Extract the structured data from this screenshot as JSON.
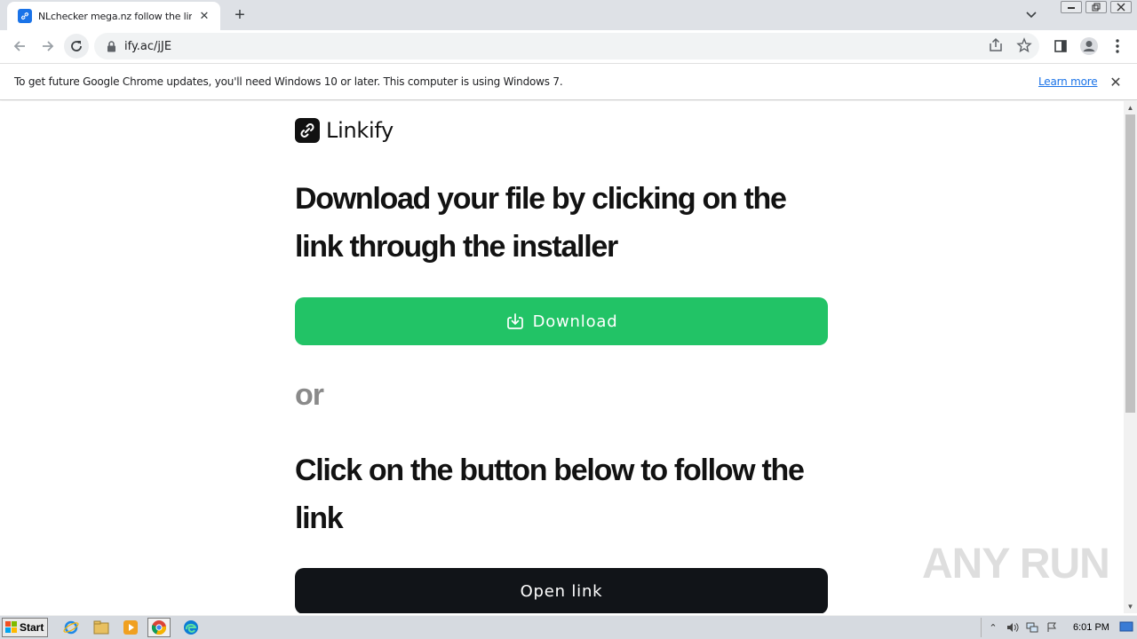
{
  "browser": {
    "tab_title": "NLchecker mega.nz follow the link —",
    "url": "ify.ac/jJE"
  },
  "infobar": {
    "message": "To get future Google Chrome updates, you'll need Windows 10 or later. This computer is using Windows 7.",
    "link_label": "Learn more"
  },
  "page": {
    "brand": "Linkify",
    "heading_download": "Download your file by clicking on the link through the installer",
    "download_label": "Download",
    "or_label": "or",
    "heading_follow": "Click on the button below to follow the link",
    "open_link_label": "Open link",
    "accent_color": "#22c366"
  },
  "watermark": "ANY RUN",
  "taskbar": {
    "start_label": "Start",
    "clock": "6:01 PM"
  }
}
